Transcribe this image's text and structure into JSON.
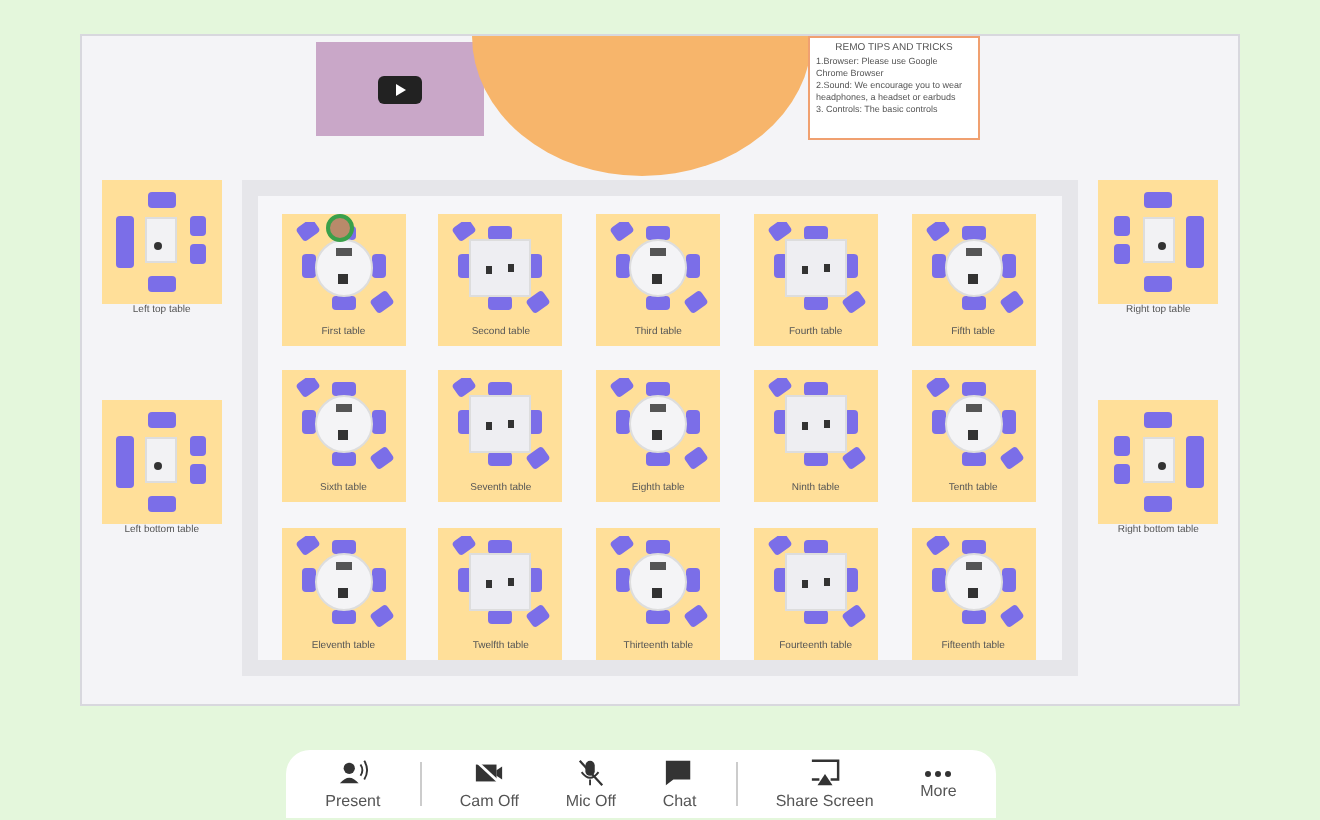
{
  "tips": {
    "title": "REMO TIPS AND TRICKS",
    "items": [
      "1.Browser: Please use Google Chrome Browser",
      "2.Sound: We encourage you to wear headphones, a headset or earbuds",
      "3. Controls: The basic controls"
    ]
  },
  "left_tables": [
    {
      "label": "Left top table",
      "kind": "lounge"
    },
    {
      "label": "Left bottom table",
      "kind": "lounge"
    }
  ],
  "right_tables": [
    {
      "label": "Right top table",
      "kind": "lounge"
    },
    {
      "label": "Right bottom table",
      "kind": "lounge"
    }
  ],
  "tables": [
    {
      "label": "First table",
      "kind": "round",
      "attendee": true
    },
    {
      "label": "Second table",
      "kind": "square",
      "attendee": false
    },
    {
      "label": "Third table",
      "kind": "round",
      "attendee": false
    },
    {
      "label": "Fourth table",
      "kind": "square",
      "attendee": false
    },
    {
      "label": "Fifth table",
      "kind": "round",
      "attendee": false
    },
    {
      "label": "Sixth table",
      "kind": "round",
      "attendee": false
    },
    {
      "label": "Seventh table",
      "kind": "square",
      "attendee": false
    },
    {
      "label": "Eighth table",
      "kind": "round",
      "attendee": false
    },
    {
      "label": "Ninth table",
      "kind": "square",
      "attendee": false
    },
    {
      "label": "Tenth table",
      "kind": "round",
      "attendee": false
    },
    {
      "label": "Eleventh table",
      "kind": "round",
      "attendee": false
    },
    {
      "label": "Twelfth table",
      "kind": "square",
      "attendee": false
    },
    {
      "label": "Thirteenth table",
      "kind": "round",
      "attendee": false
    },
    {
      "label": "Fourteenth table",
      "kind": "square",
      "attendee": false
    },
    {
      "label": "Fifteenth table",
      "kind": "round",
      "attendee": false
    }
  ],
  "toolbar": [
    {
      "label": "Present",
      "kind": "present",
      "separator_after": true
    },
    {
      "label": "Cam Off",
      "kind": "cam",
      "separator_after": false
    },
    {
      "label": "Mic Off",
      "kind": "mic",
      "separator_after": false
    },
    {
      "label": "Chat",
      "kind": "chat",
      "separator_after": true
    },
    {
      "label": "Share Screen",
      "kind": "share",
      "separator_after": false
    },
    {
      "label": "More",
      "kind": "more",
      "separator_after": false
    }
  ]
}
